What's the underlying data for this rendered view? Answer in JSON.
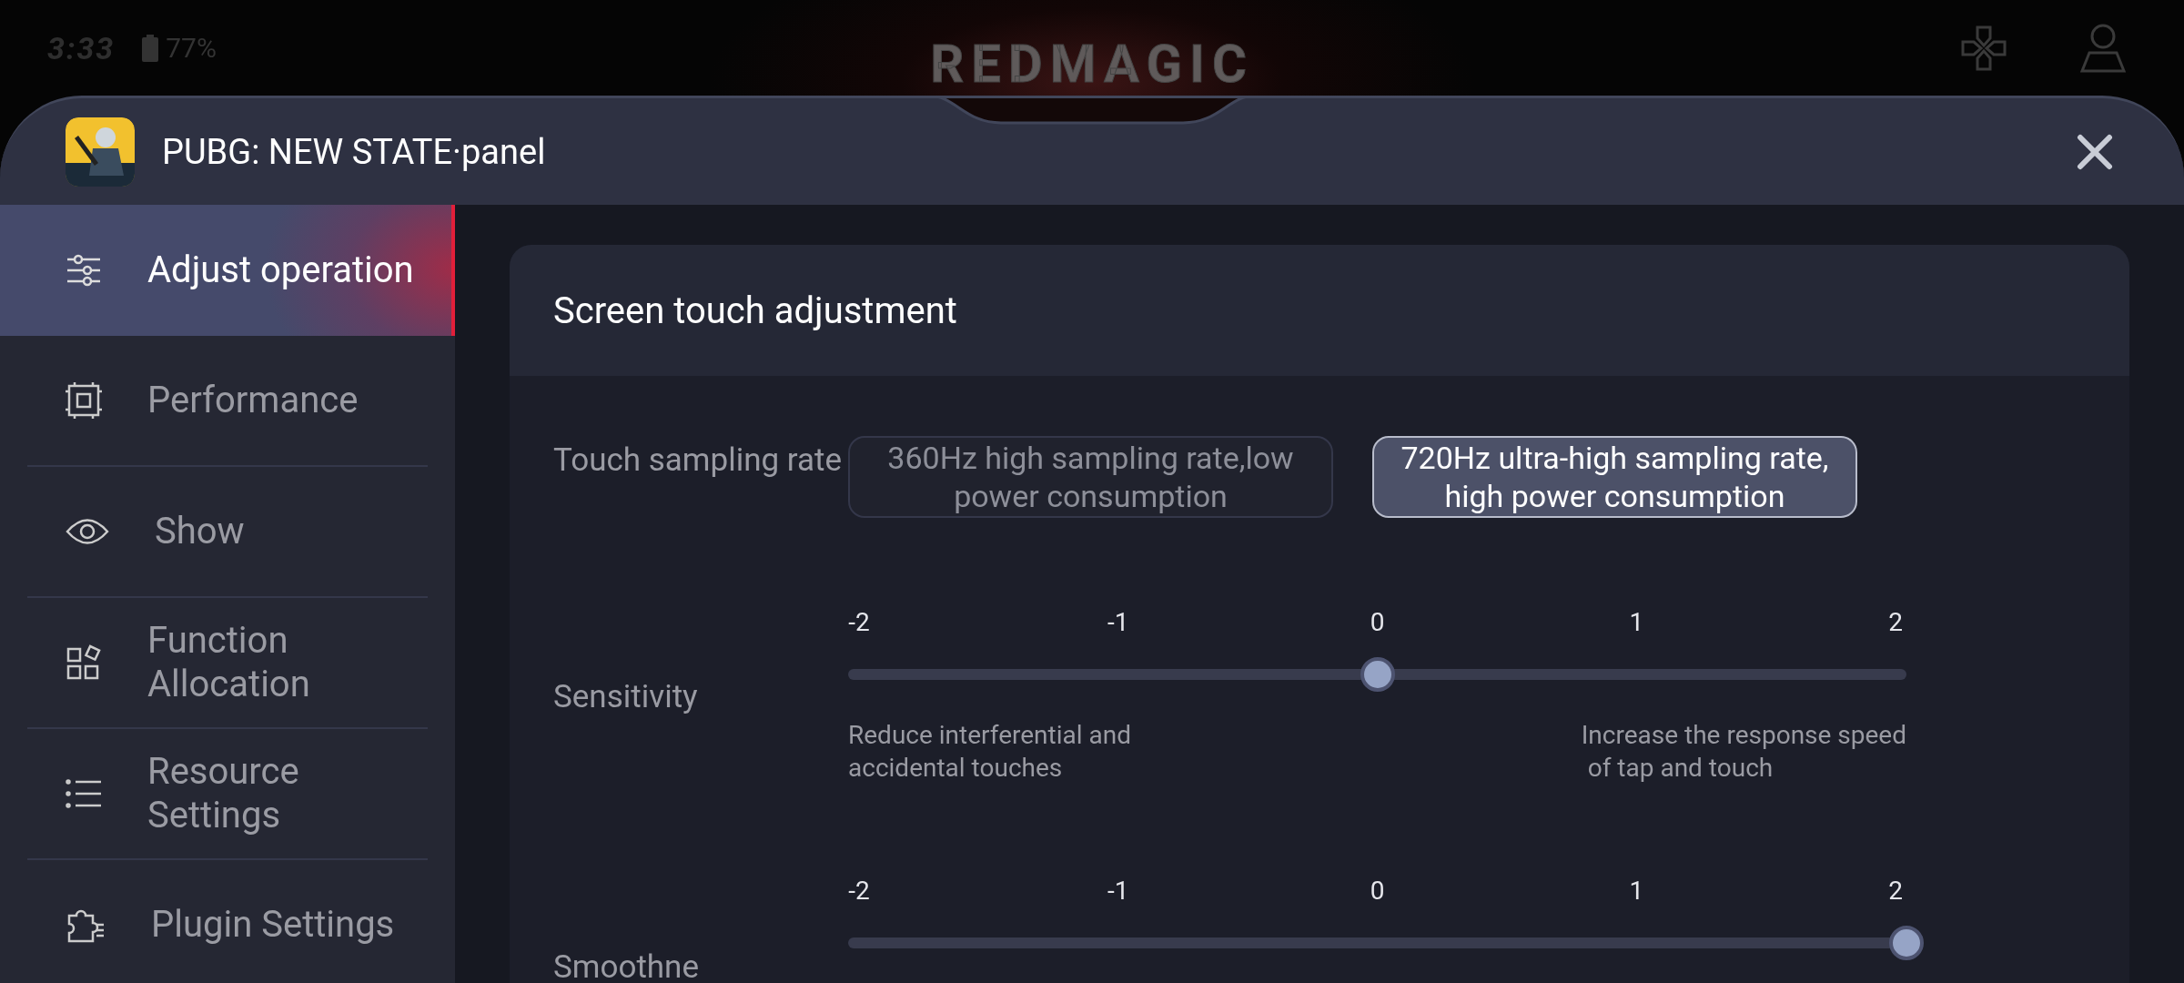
{
  "status_bar": {
    "time": "3:33",
    "battery": "77%"
  },
  "logo": "REDMAGIC",
  "panel": {
    "title": "PUBG: NEW STATE·panel"
  },
  "sidebar": {
    "items": [
      {
        "label": "Adjust operation",
        "selected": true
      },
      {
        "label": "Performance",
        "selected": false
      },
      {
        "label": "Show",
        "selected": false
      },
      {
        "label": "Function Allocation",
        "selected": false
      },
      {
        "label": "Resource Settings",
        "selected": false
      },
      {
        "label": "Plugin Settings",
        "selected": false
      }
    ]
  },
  "card": {
    "title": "Screen touch adjustment",
    "settings": [
      {
        "kind": "options",
        "label": "Touch sampling rate",
        "options": [
          {
            "label": "360Hz high sampling rate,low power consumption",
            "selected": false
          },
          {
            "label": "720Hz ultra-high sampling rate, high power consumption",
            "selected": true
          }
        ]
      },
      {
        "kind": "slider",
        "label": "Sensitivity",
        "ticks": [
          "-2",
          "-1",
          "0",
          "1",
          "2"
        ],
        "level": 0.5,
        "hints": [
          "Reduce interferential and\naccidental touches",
          "Increase the response speed\n of tap and touch"
        ]
      },
      {
        "kind": "slider",
        "label": "Smoothne",
        "ticks": [
          "-2",
          "-1",
          "0",
          "1",
          "2"
        ],
        "level": 1
      }
    ]
  }
}
